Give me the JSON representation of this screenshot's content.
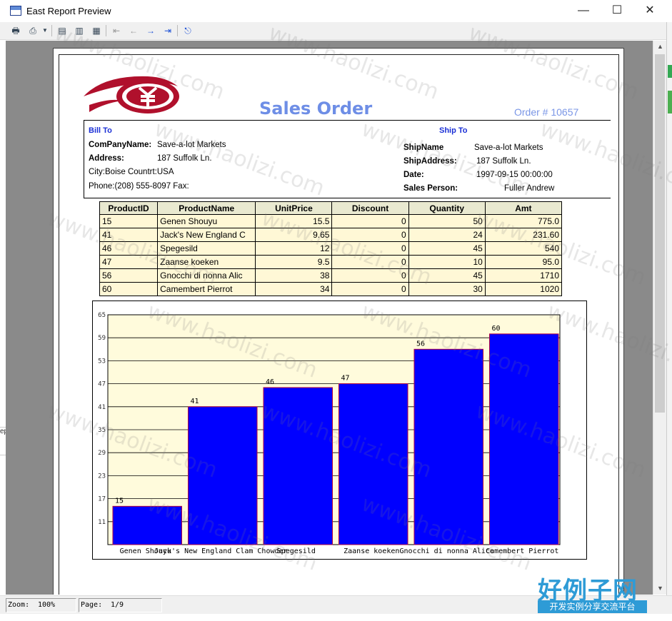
{
  "window": {
    "title": "East Report Preview",
    "minimize": "—",
    "maximize": "☐",
    "close": "✕"
  },
  "toolbar": {
    "buttons": [
      {
        "name": "print-icon",
        "glyph": "🖶"
      },
      {
        "name": "export-icon",
        "glyph": "⎙"
      },
      {
        "name": "dropdown-arrow-icon",
        "glyph": "▼"
      },
      {
        "name": "single-page-icon",
        "glyph": "▤"
      },
      {
        "name": "two-pages-icon",
        "glyph": "▥"
      },
      {
        "name": "multi-pages-icon",
        "glyph": "▦"
      },
      {
        "name": "first-page-icon",
        "glyph": "⇤"
      },
      {
        "name": "previous-page-icon",
        "glyph": "←"
      },
      {
        "name": "next-page-icon",
        "glyph": "→"
      },
      {
        "name": "last-page-icon",
        "glyph": "⇥"
      },
      {
        "name": "exit-icon",
        "glyph": "⎋"
      }
    ]
  },
  "report": {
    "title": "Sales Order",
    "order_no": "Order # 10657",
    "bill_to": {
      "heading": "Bill To",
      "company_label": "ComPanyName:",
      "company": "Save-a-lot Markets",
      "address_label": "Address:",
      "address": "187 Suffolk Ln.",
      "city_line": "City:Boise  Countrt:USA",
      "phone_line": "Phone:(208) 555-8097 Fax:"
    },
    "ship_to": {
      "heading": "Ship To",
      "name_label": "ShipName",
      "name": "Save-a-lot Markets",
      "address_label": "ShipAddress:",
      "address": "187 Suffolk Ln.",
      "date_label": "Date:",
      "date": "1997-09-15 00:00:00",
      "person_label": "Sales Person:",
      "person": "Fuller   Andrew"
    },
    "table": {
      "columns": [
        "ProductID",
        "ProductName",
        "UnitPrice",
        "Discount",
        "Quantity",
        "Amt"
      ],
      "rows": [
        [
          "15",
          "Genen Shouyu",
          "15.5",
          "0",
          "50",
          "775.0"
        ],
        [
          "41",
          "Jack's New England C",
          "9.65",
          "0",
          "24",
          "231.60"
        ],
        [
          "46",
          "Spegesild",
          "12",
          "0",
          "45",
          "540"
        ],
        [
          "47",
          "Zaanse koeken",
          "9.5",
          "0",
          "10",
          "95.0"
        ],
        [
          "56",
          "Gnocchi di nonna Alic",
          "38",
          "0",
          "45",
          "1710"
        ],
        [
          "60",
          "Camembert Pierrot",
          "34",
          "0",
          "30",
          "1020"
        ]
      ]
    }
  },
  "chart_data": {
    "type": "bar",
    "categories": [
      "Genen Shouyu",
      "Jack's New England Clam Chowder",
      "Spegesild",
      "Zaanse koeken",
      "Gnocchi di nonna Alice",
      "Camembert Pierrot"
    ],
    "values": [
      15,
      41,
      46,
      47,
      56,
      60
    ],
    "ylim": [
      5,
      65
    ],
    "yticks": [
      11,
      17,
      23,
      29,
      35,
      41,
      47,
      53,
      59,
      65
    ],
    "grid": true,
    "bar_color": "#0000ff",
    "plot_background": "#fffbdc"
  },
  "status": {
    "zoom_label": "Zoom:",
    "zoom_value": "100%",
    "page_label": "Page:",
    "page_value": "1/9"
  },
  "watermark_text": "www.haolizi.com",
  "brand": {
    "main": "好例子网",
    "sub": "开发实例分享交流平台"
  },
  "left_edge_text": "ep"
}
